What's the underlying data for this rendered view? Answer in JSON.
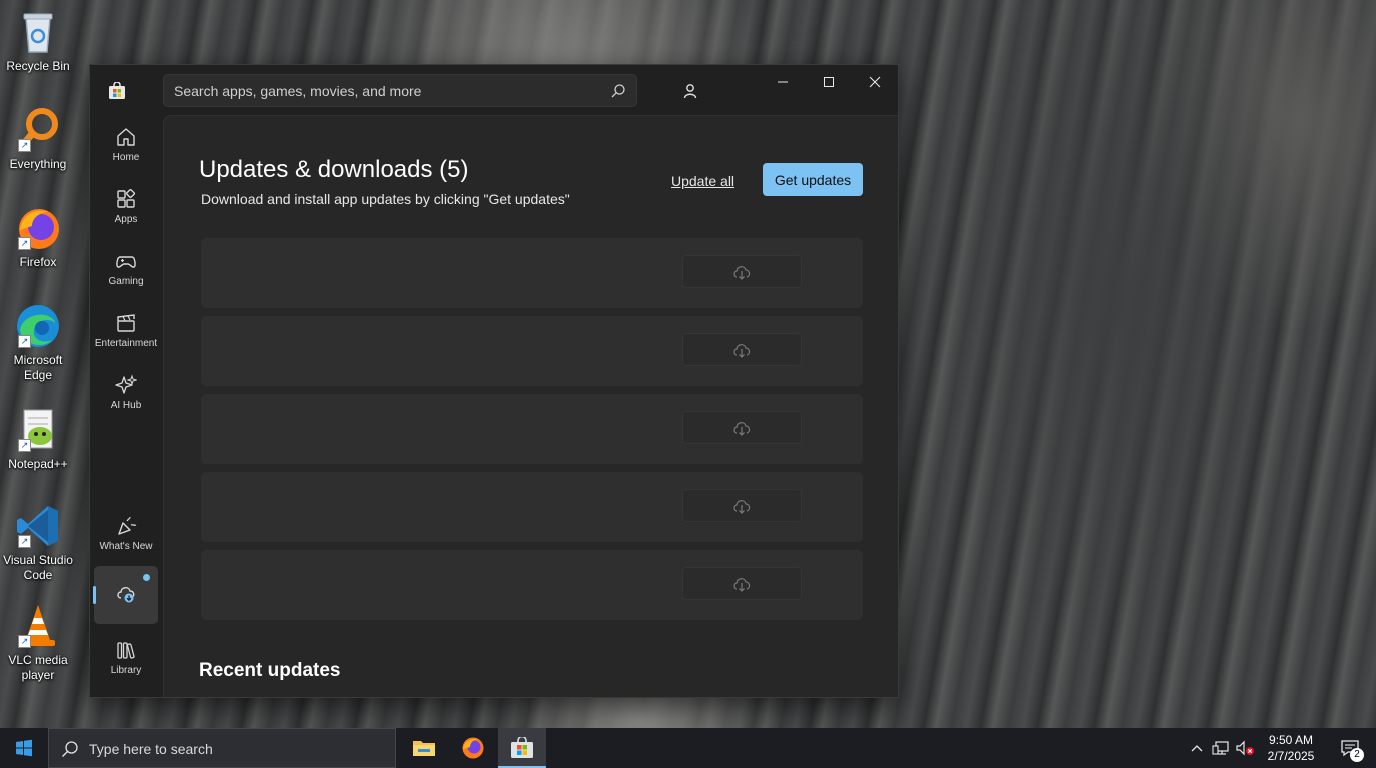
{
  "desktop": {
    "icons": [
      {
        "label": "Recycle Bin"
      },
      {
        "label": "Everything"
      },
      {
        "label": "Firefox"
      },
      {
        "label": "Microsoft Edge"
      },
      {
        "label": "Notepad++"
      },
      {
        "label": "Visual Studio Code"
      },
      {
        "label": "VLC media player"
      }
    ]
  },
  "store": {
    "search_placeholder": "Search apps, games, movies, and more",
    "nav": [
      {
        "label": "Home",
        "icon": "home-icon"
      },
      {
        "label": "Apps",
        "icon": "apps-icon"
      },
      {
        "label": "Gaming",
        "icon": "gamepad-icon"
      },
      {
        "label": "Entertainment",
        "icon": "clapperboard-icon"
      },
      {
        "label": "AI Hub",
        "icon": "sparkle-icon"
      },
      {
        "label": "What's New",
        "icon": "party-icon"
      },
      {
        "label": "Downloads",
        "icon": "cloud-download-icon",
        "active": true
      },
      {
        "label": "Library",
        "icon": "library-icon"
      }
    ],
    "page": {
      "title": "Updates & downloads (5)",
      "subtitle": "Download and install app updates by clicking \"Get updates\"",
      "update_all": "Update all",
      "get_updates": "Get updates",
      "rows": 5,
      "recent_title": "Recent updates"
    },
    "colors": {
      "accent": "#7cc2f2",
      "window_bg": "#202020",
      "panel_bg": "#272727",
      "row_bg": "#2f2f2f"
    }
  },
  "taskbar": {
    "search_placeholder": "Type here to search",
    "apps": [
      "File Explorer",
      "Firefox",
      "Microsoft Store"
    ],
    "clock": {
      "time": "9:50 AM",
      "date": "2/7/2025"
    },
    "notifications": "2"
  }
}
